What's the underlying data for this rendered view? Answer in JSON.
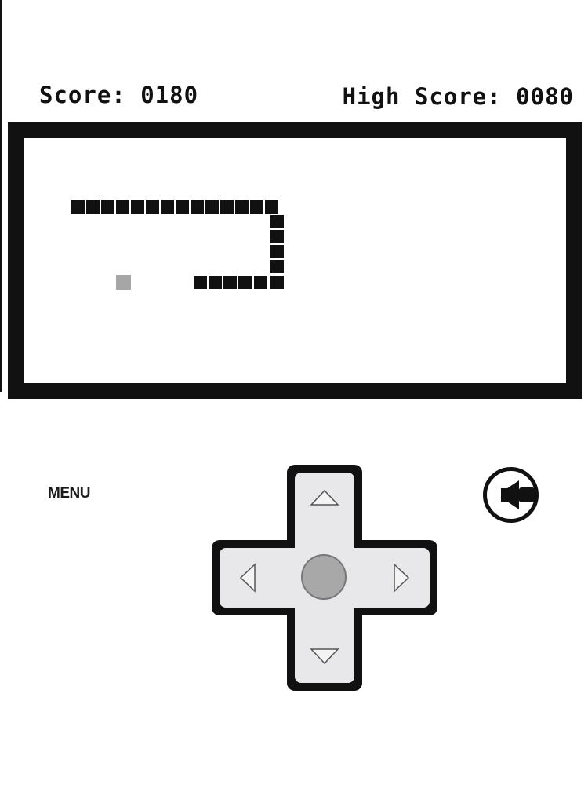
{
  "header": {
    "score_label": "Score: 0180",
    "high_score_label": "High Score: 0080"
  },
  "controls": {
    "menu_label": "MENU",
    "dpad": [
      "up",
      "down",
      "left",
      "right"
    ],
    "sound_icon": "speaker-icon"
  },
  "colors": {
    "border": "#111111",
    "snake": "#111111",
    "food": "#a6a6a6",
    "dpad_fill": "#e8e8ea",
    "dpad_center": "#a8a8a8"
  }
}
